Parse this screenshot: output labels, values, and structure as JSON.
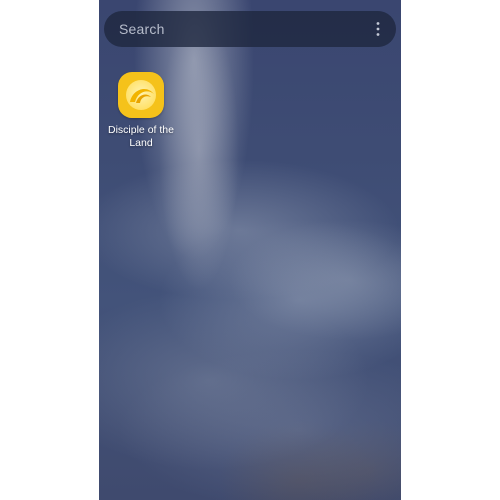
{
  "search": {
    "placeholder": "Search",
    "more_icon": "more-vert-icon"
  },
  "apps": [
    {
      "label": "Disciple of the Land",
      "icon": "crescent-app-icon",
      "icon_color": "#f5c21a"
    }
  ],
  "colors": {
    "wallpaper": "#3e4c74",
    "search_bar": "#1e263e",
    "app_icon_bg": "#f5c21a"
  }
}
